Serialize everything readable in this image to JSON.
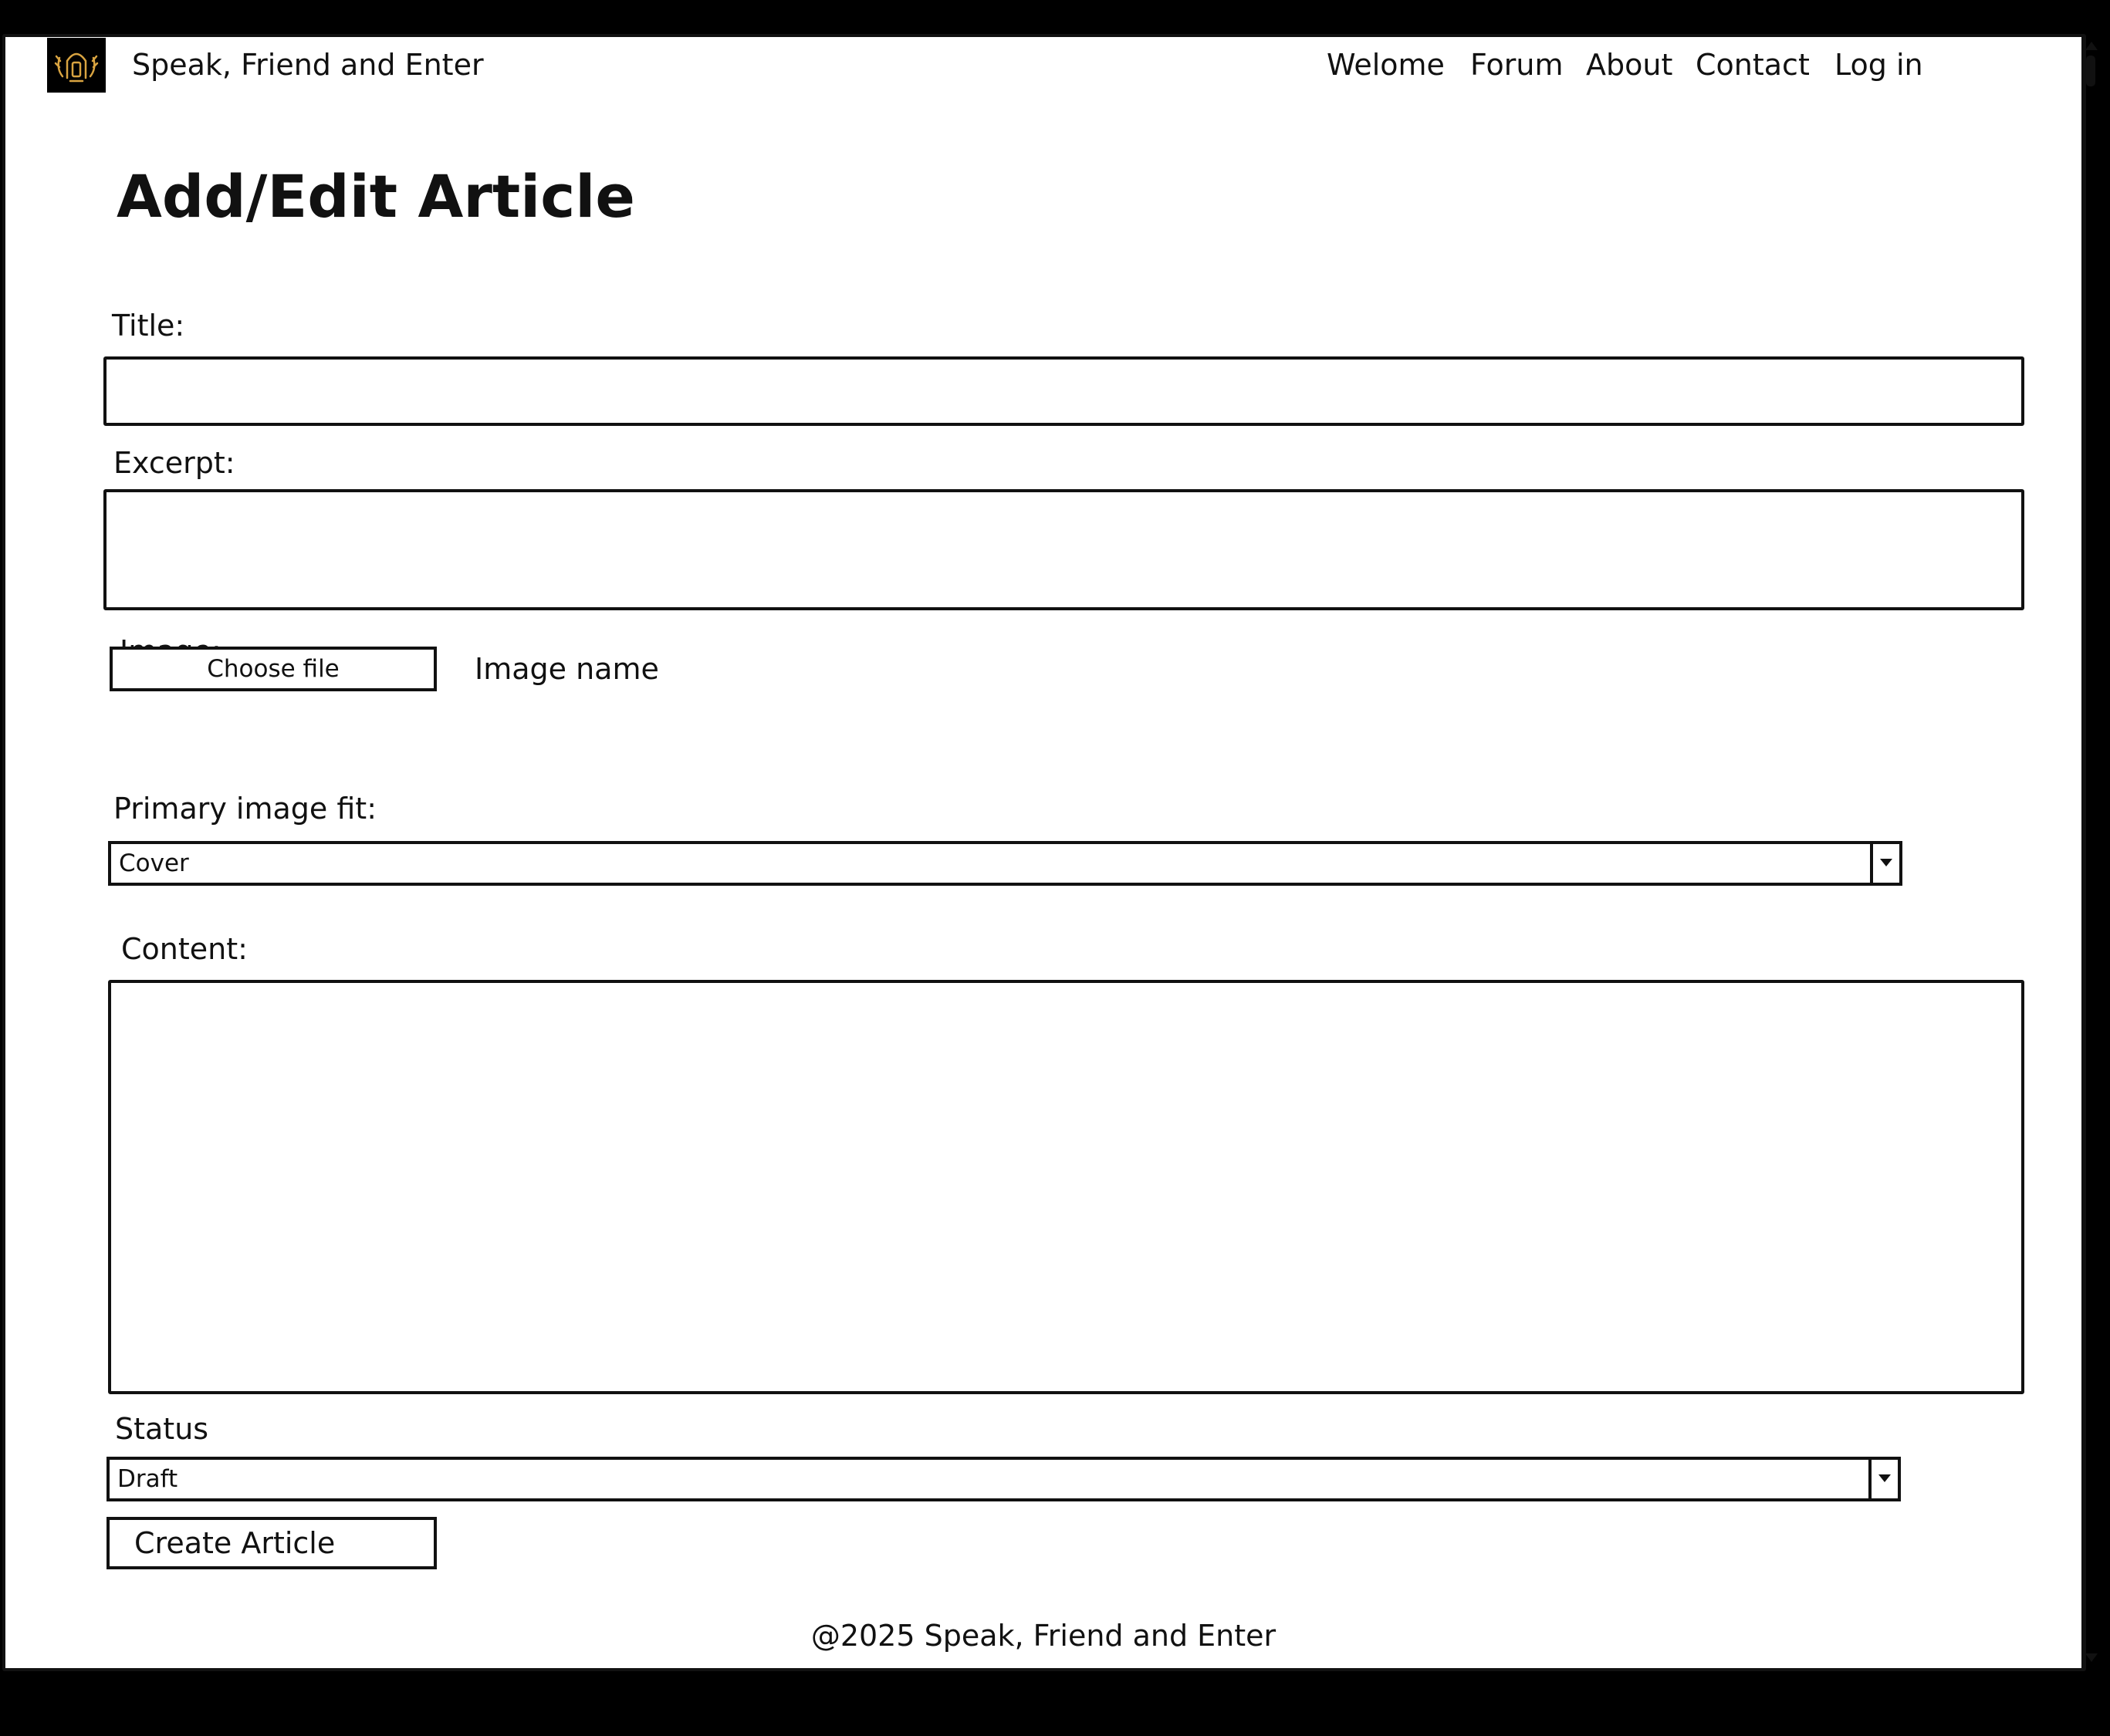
{
  "header": {
    "site_name": "Speak, Friend and Enter",
    "nav": [
      "Welome",
      "Forum",
      "About",
      "Contact",
      "Log in"
    ]
  },
  "page": {
    "title": "Add/Edit Article"
  },
  "form": {
    "title_label": "Title:",
    "title_value": "",
    "excerpt_label": "Excerpt:",
    "excerpt_value": "",
    "image_label": "Image:",
    "choose_file_label": "Choose file",
    "image_name": "Image name",
    "fit_label": "Primary image fit:",
    "fit_value": "Cover",
    "content_label": "Content:",
    "content_value": "",
    "status_label": "Status",
    "status_value": "Draft",
    "submit_label": "Create Article"
  },
  "footer": {
    "text": "@2025 Speak, Friend and Enter"
  },
  "colors": {
    "background": "#ffffff",
    "frame": "#000000",
    "ink": "#111111",
    "logo_accent": "#d9a441"
  }
}
